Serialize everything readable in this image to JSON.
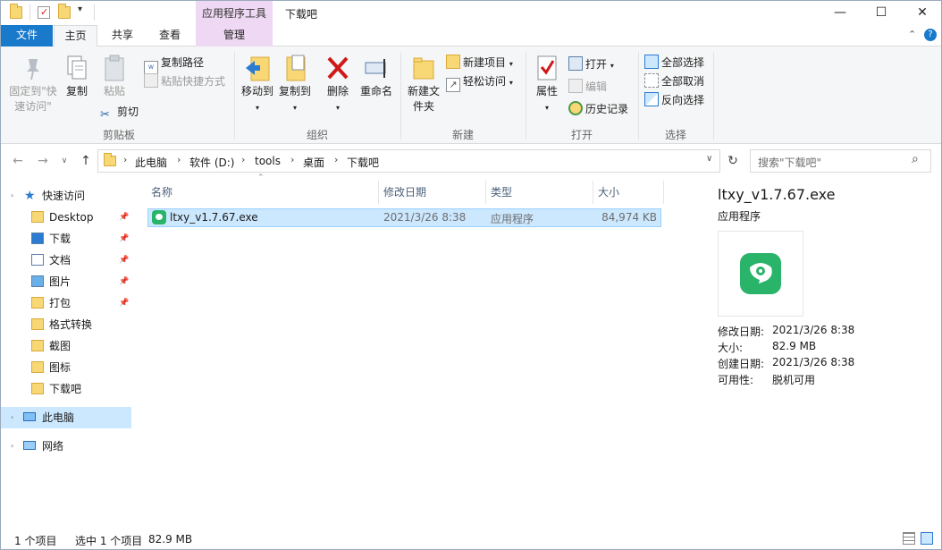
{
  "window": {
    "title": "下载吧",
    "context_tab_header": "应用程序工具",
    "controls": {
      "minimize": "—",
      "maximize": "☐",
      "close": "✕"
    }
  },
  "ribbon_tabs": {
    "file": "文件",
    "home": "主页",
    "share": "共享",
    "view": "查看",
    "manage": "管理"
  },
  "ribbon": {
    "clipboard": {
      "pin_quick_access": "固定到\"快速访问\"",
      "copy": "复制",
      "paste": "粘贴",
      "copy_path": "复制路径",
      "paste_shortcut": "粘贴快捷方式",
      "cut": "剪切",
      "label": "剪贴板"
    },
    "organize": {
      "move_to": "移动到",
      "copy_to": "复制到",
      "delete": "删除",
      "rename": "重命名",
      "label": "组织"
    },
    "new": {
      "new_folder": "新建文件夹",
      "new_item": "新建项目",
      "easy_access": "轻松访问",
      "label": "新建"
    },
    "open": {
      "properties": "属性",
      "open": "打开",
      "edit": "编辑",
      "history": "历史记录",
      "label": "打开"
    },
    "select": {
      "select_all": "全部选择",
      "select_none": "全部取消",
      "invert": "反向选择",
      "label": "选择"
    }
  },
  "address": {
    "crumbs": [
      "此电脑",
      "软件 (D:)",
      "tools",
      "桌面",
      "下载吧"
    ],
    "search_placeholder": "搜索\"下载吧\""
  },
  "nav": {
    "quick_access": "快速访问",
    "items": [
      {
        "label": "Desktop",
        "icon": "folder-icon",
        "pinned": true
      },
      {
        "label": "下载",
        "icon": "download-icon",
        "pinned": true
      },
      {
        "label": "文档",
        "icon": "document-icon",
        "pinned": true
      },
      {
        "label": "图片",
        "icon": "picture-icon",
        "pinned": true
      },
      {
        "label": "打包",
        "icon": "folder-icon",
        "pinned": true
      },
      {
        "label": "格式转换",
        "icon": "folder-icon",
        "pinned": false
      },
      {
        "label": "截图",
        "icon": "folder-icon",
        "pinned": false
      },
      {
        "label": "图标",
        "icon": "folder-icon",
        "pinned": false
      },
      {
        "label": "下载吧",
        "icon": "folder-icon",
        "pinned": false
      }
    ],
    "this_pc": "此电脑",
    "network": "网络"
  },
  "columns": {
    "name": "名称",
    "date": "修改日期",
    "type": "类型",
    "size": "大小"
  },
  "files": [
    {
      "name": "ltxy_v1.7.67.exe",
      "date": "2021/3/26 8:38",
      "type": "应用程序",
      "size": "84,974 KB",
      "selected": true
    }
  ],
  "preview": {
    "name": "ltxy_v1.7.67.exe",
    "type": "应用程序",
    "modified_key": "修改日期:",
    "modified_val": "2021/3/26 8:38",
    "size_key": "大小:",
    "size_val": "82.9 MB",
    "created_key": "创建日期:",
    "created_val": "2021/3/26 8:38",
    "availability_key": "可用性:",
    "availability_val": "脱机可用"
  },
  "status": {
    "count": "1 个项目",
    "selected": "选中 1 个项目",
    "selected_size": "82.9 MB"
  },
  "colors": {
    "file_tab": "#1979ca",
    "selection": "#cce8ff",
    "context_tab": "#efd8f3",
    "app_icon": "#2ab46a"
  }
}
